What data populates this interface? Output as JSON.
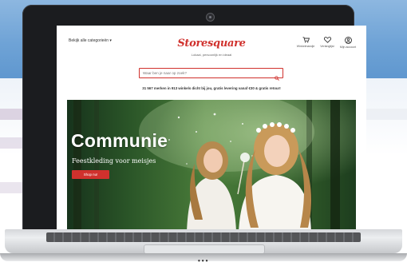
{
  "site": {
    "logo": "Storesquare",
    "tagline": "Lokaal, persoonlijk en ideaal",
    "categories_label": "Bekijk alle categorieën ▾",
    "header_icons": [
      {
        "icon": "cart-icon",
        "label": "Winkelmandje"
      },
      {
        "icon": "heart-icon",
        "label": "Verlanglijst"
      },
      {
        "icon": "user-icon",
        "label": "Mijn account"
      }
    ],
    "search": {
      "placeholder": "Waar ben je naar op zoek?",
      "value": "",
      "icon": "search-icon"
    },
    "usp": "31 567 merken in 913 winkels dicht bij jou, gratis levering vanaf €30 & gratis retour!",
    "hero": {
      "title": "Communie",
      "subtitle": "Feestkleding voor meisjes",
      "button": "Shop nu!"
    }
  },
  "device": {
    "indicator": "•••"
  },
  "colors": {
    "accent": "#d0312d",
    "bezel": "#1b1c1f",
    "backdrop_blue": "#6fa3d6"
  }
}
